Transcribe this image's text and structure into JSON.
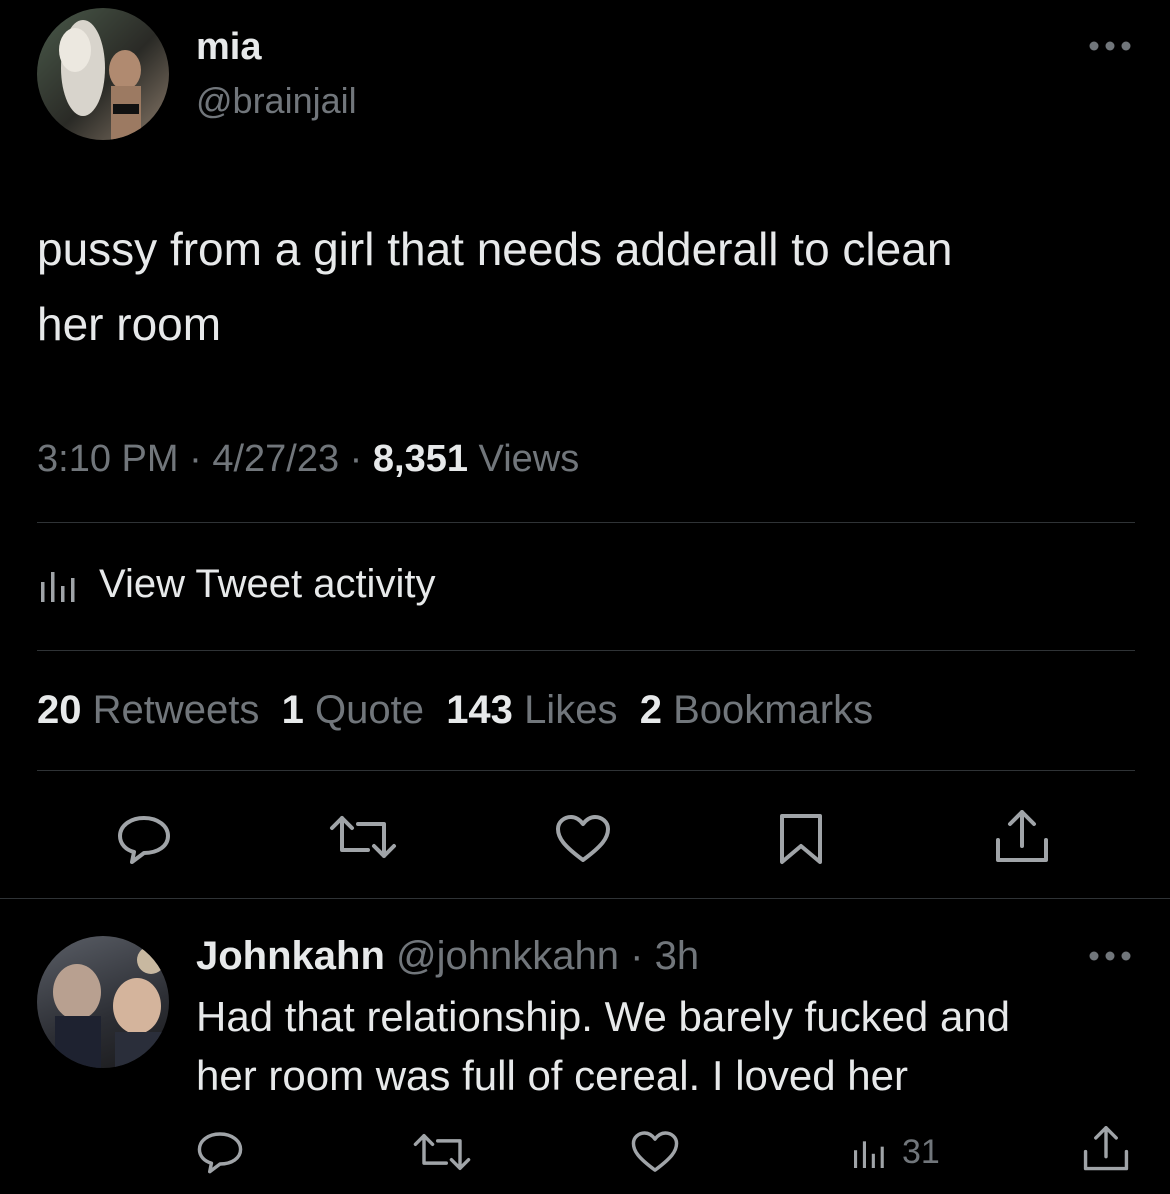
{
  "tweet": {
    "author_name": "mia",
    "author_handle": "@brainjail",
    "text_line1": "pussy from a girl that needs adderall to clean",
    "text_line2": "her room",
    "time": "3:10 PM",
    "sep1": "·",
    "date": "4/27/23",
    "sep2": "·",
    "views_count": "8,351",
    "views_label": "Views",
    "activity_label": "View Tweet activity",
    "stats": {
      "retweets_count": "20",
      "retweets_label": "Retweets",
      "quotes_count": "1",
      "quotes_label": "Quote",
      "likes_count": "143",
      "likes_label": "Likes",
      "bookmarks_count": "2",
      "bookmarks_label": "Bookmarks"
    },
    "actions": [
      "reply-icon",
      "retweet-icon",
      "like-icon",
      "bookmark-icon",
      "share-icon"
    ]
  },
  "reply": {
    "author_name": "Johnkahn",
    "author_handle": "@johnkkahn",
    "sep": "·",
    "age": "3h",
    "text_line1": "Had that relationship. We barely fucked and",
    "text_line2": "her room was full of cereal. I loved her",
    "views_count": "31"
  },
  "colors": {
    "background": "#000000",
    "text": "#e7e9ea",
    "muted": "#71767b",
    "divider": "#2f3336"
  }
}
